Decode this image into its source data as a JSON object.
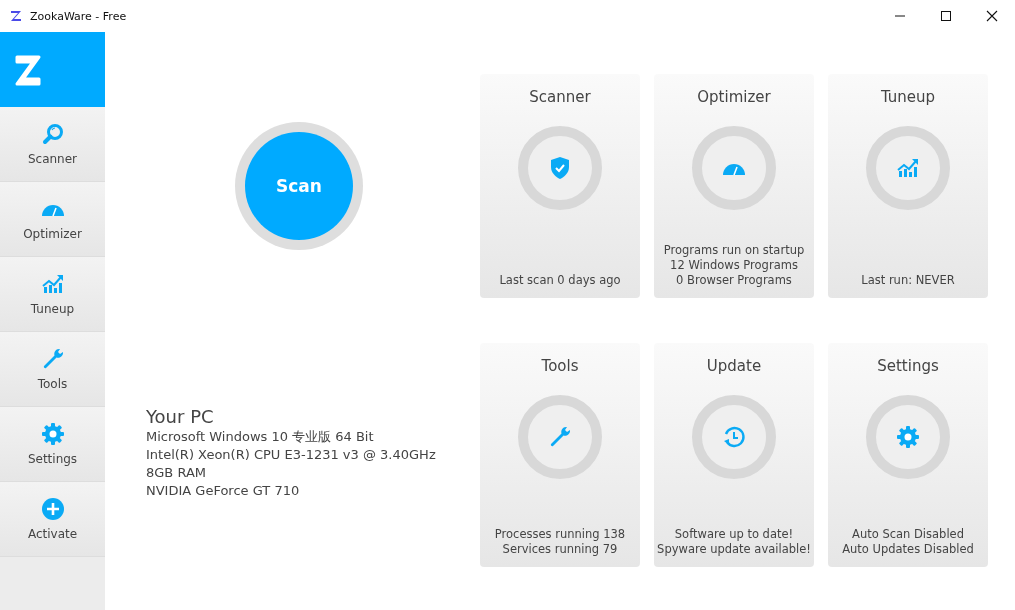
{
  "window": {
    "title": "ZookaWare - Free"
  },
  "sidebar": {
    "items": [
      {
        "label": "Scanner",
        "kind": "search"
      },
      {
        "label": "Optimizer",
        "kind": "gauge"
      },
      {
        "label": "Tuneup",
        "kind": "chart"
      },
      {
        "label": "Tools",
        "kind": "wrench"
      },
      {
        "label": "Settings",
        "kind": "gear"
      },
      {
        "label": "Activate",
        "kind": "plus"
      }
    ]
  },
  "scan_button": {
    "label": "Scan"
  },
  "your_pc": {
    "title": "Your PC",
    "lines": [
      "Microsoft Windows 10 专业版 64 Bit",
      "Intel(R) Xeon(R) CPU E3-1231 v3 @ 3.40GHz",
      "8GB RAM",
      "NVIDIA GeForce GT 710"
    ]
  },
  "cards": [
    {
      "title": "Scanner",
      "kind": "shield",
      "lines": [
        "Last scan 0 days ago"
      ]
    },
    {
      "title": "Optimizer",
      "kind": "gauge",
      "lines": [
        "Programs run on startup",
        "12 Windows Programs",
        "0 Browser Programs"
      ]
    },
    {
      "title": "Tuneup",
      "kind": "chart",
      "lines": [
        "Last run: NEVER"
      ]
    },
    {
      "title": "Tools",
      "kind": "wrench",
      "lines": [
        "Processes running 138",
        "Services running 79"
      ]
    },
    {
      "title": "Update",
      "kind": "history",
      "lines": [
        "Software up to date!",
        "Spyware update available!"
      ]
    },
    {
      "title": "Settings",
      "kind": "gear",
      "lines": [
        "Auto Scan Disabled",
        "Auto Updates Disabled"
      ]
    }
  ]
}
